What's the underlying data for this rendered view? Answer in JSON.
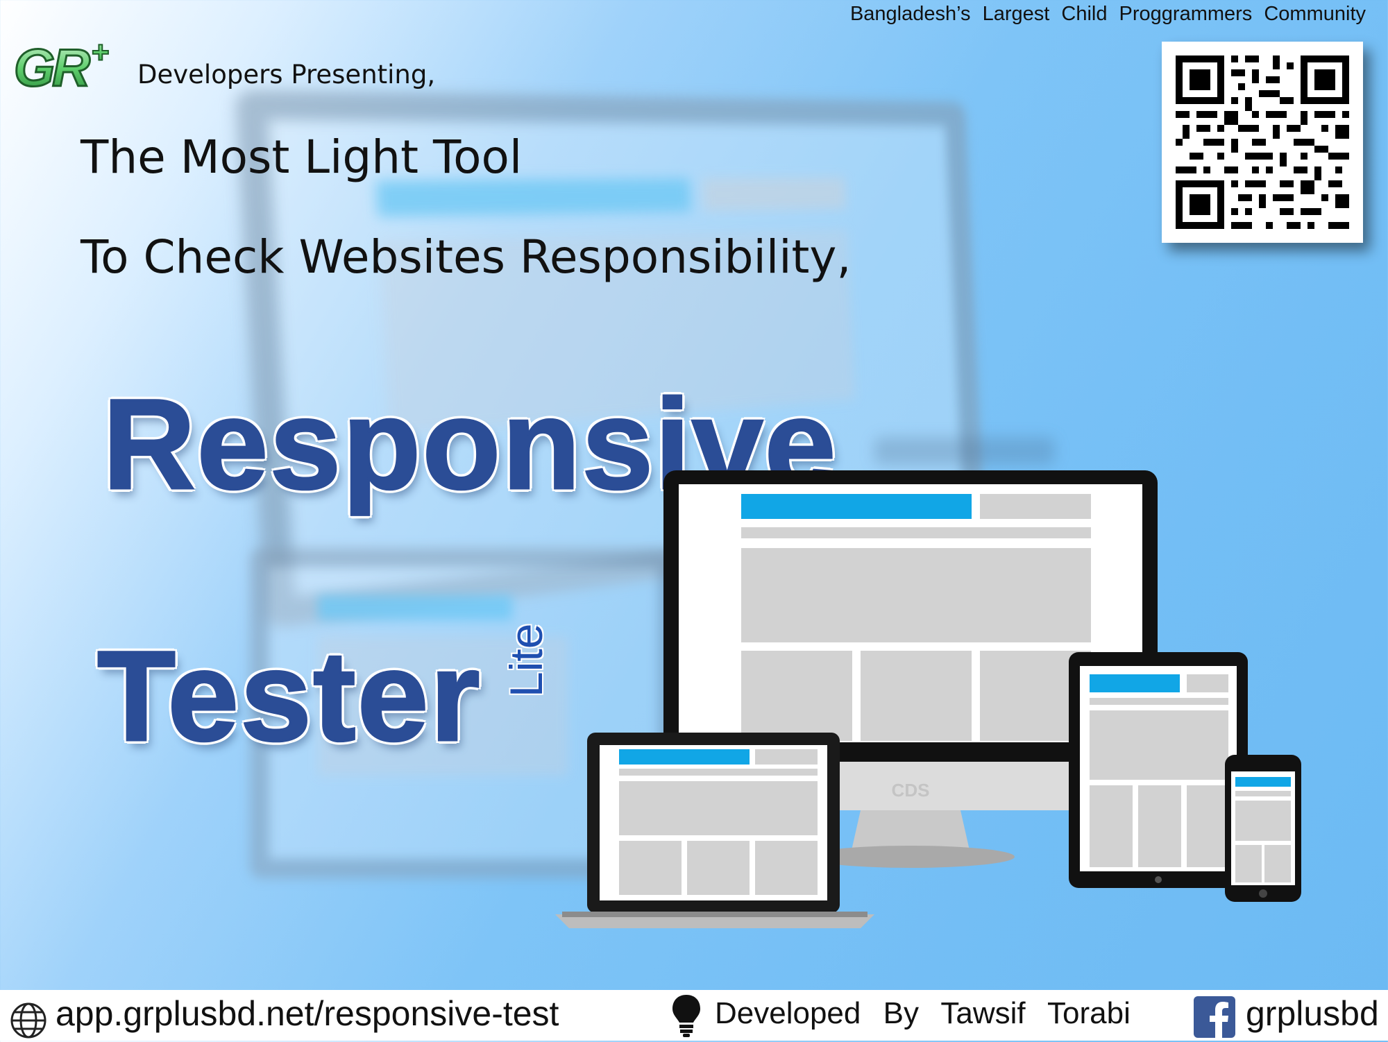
{
  "header": {
    "tagline": "Bangladesh’s  Largest  Child  Proggrammers  Community",
    "logo_text": "GR+",
    "presenting": "Developers Presenting,"
  },
  "headline": {
    "line1": "The Most Light Tool",
    "line2": "To Check Websites Responsibility,"
  },
  "title": {
    "word1": "Responsive",
    "word2": "Tester",
    "badge": "Lite"
  },
  "devices": {
    "monitor_brand": "CDS"
  },
  "footer": {
    "url": "app.grplusbd.net/responsive-test",
    "developer": "Developed  By  Tawsif  Torabi",
    "facebook": "grplusbd"
  },
  "colors": {
    "title_blue": "#2b4d96",
    "accent_blue": "#29a8e8",
    "sky_blue": "#73bef5",
    "logo_green": "#3fa34d"
  },
  "icons": [
    "globe-icon",
    "lightbulb-icon",
    "facebook-icon",
    "qr-code"
  ]
}
